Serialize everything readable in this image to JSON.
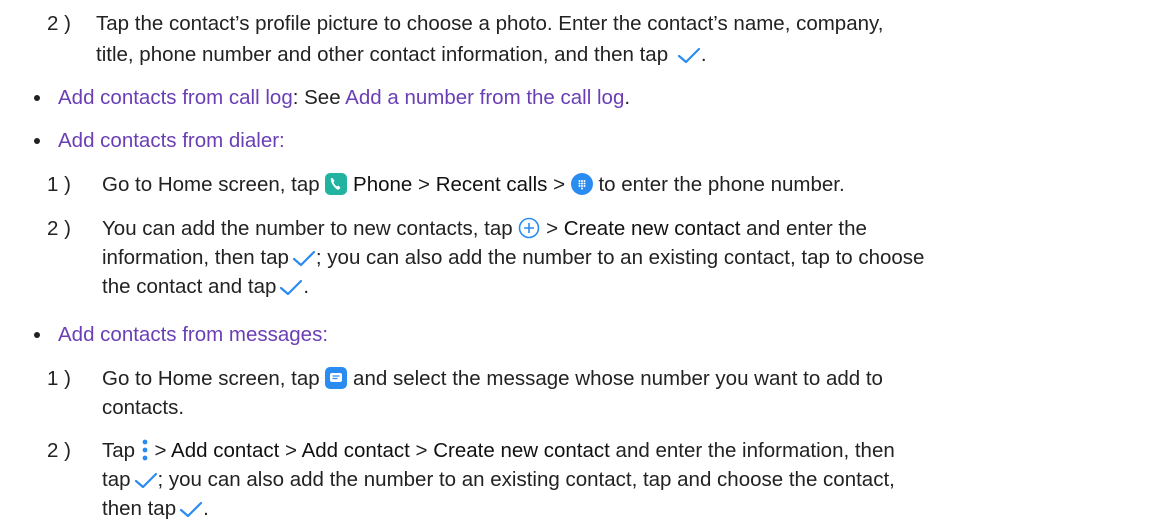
{
  "colors": {
    "link": "#6a3fb5",
    "icon_blue": "#2a8cf0",
    "phone_green": "#22b3a0"
  },
  "step_a2": {
    "num": "2 )",
    "l1": "Tap the contact’s profile picture to choose a photo. Enter the contact’s name, company,",
    "l2": "title, phone number and other contact information, and then tap",
    "l2_end": "."
  },
  "bullet_calllog": {
    "title": "Add contacts from call log",
    "sep": ": See ",
    "link": "Add a number from the call log",
    "end": "."
  },
  "bullet_dialer": {
    "title": "Add contacts from dialer:",
    "s1": {
      "num": "1 )",
      "pre": "Go to Home screen, tap",
      "phone": "Phone",
      "gt1": ">",
      "recent": "Recent calls",
      "gt2": ">",
      "post": "to enter the phone number."
    },
    "s2": {
      "num": "2 )",
      "l1a": "You can add the number to new contacts, tap",
      "l1b": ">",
      "l1c": "Create new contact",
      "l1d": "and enter the",
      "l2a": "information, then tap",
      "l2b": "; you can also add the number to an existing contact, tap to choose",
      "l3a": "the contact and tap",
      "l3b": "."
    }
  },
  "bullet_messages": {
    "title": "Add contacts from messages:",
    "s1": {
      "num": "1 )",
      "l1a": "Go to Home screen, tap",
      "l1b": "and select the message whose number you want to add to",
      "l2": "contacts."
    },
    "s2": {
      "num": "2 )",
      "tap": "Tap",
      "gt1": ">",
      "add1": "Add contact",
      "gt2": ">",
      "add2": "Add contact",
      "gt3": ">",
      "create": "Create new contact",
      "l1_end": "and enter the information, then",
      "l2a": "tap",
      "l2b": "; you can also add the number to an existing contact, tap and choose the contact,",
      "l3a": "then tap",
      "l3b": "."
    }
  },
  "icons": [
    "checkmark-icon",
    "phone-app-icon",
    "dialpad-icon",
    "add-circle-icon",
    "messages-app-icon",
    "more-vertical-icon"
  ]
}
